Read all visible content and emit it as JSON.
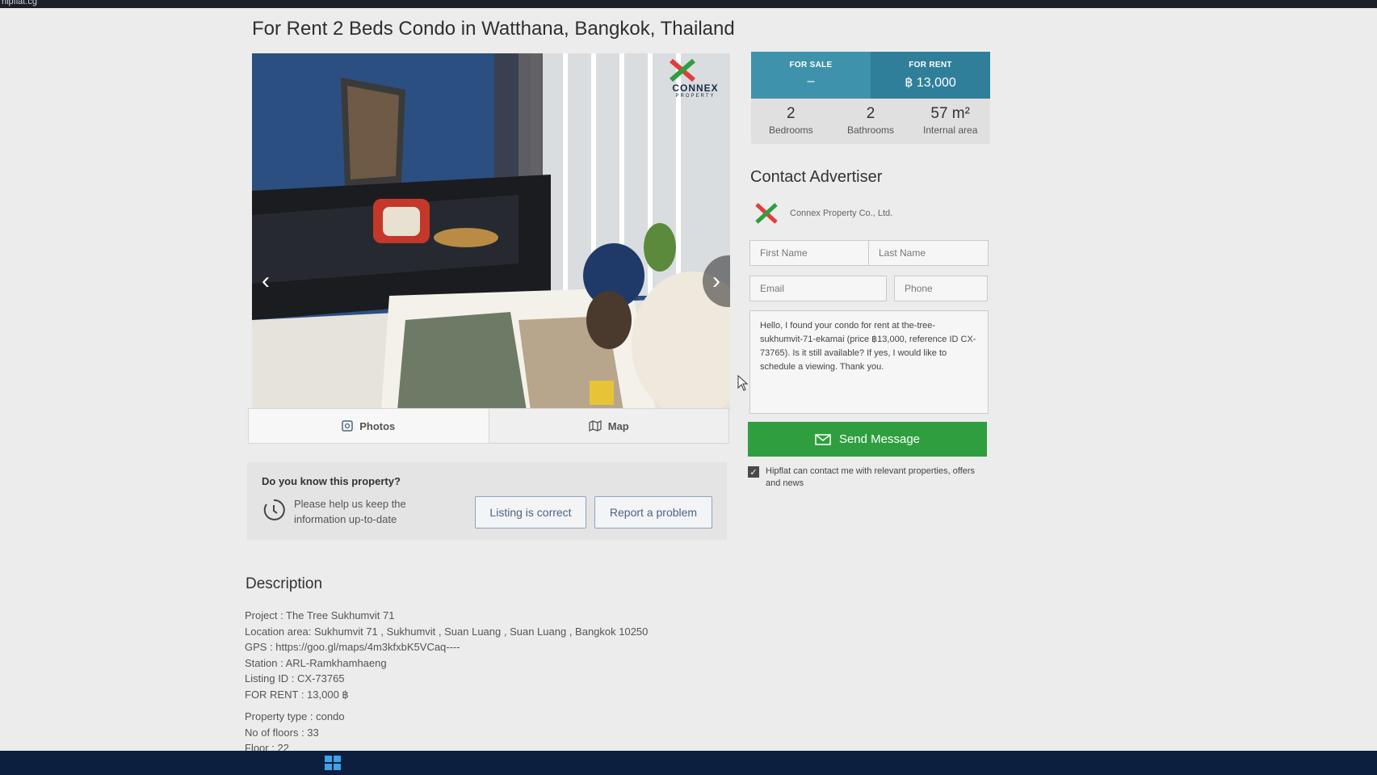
{
  "browser": {
    "url_fragment": "hipflat.cg"
  },
  "page": {
    "title": "For Rent 2 Beds Condo in Watthana, Bangkok, Thailand"
  },
  "gallery": {
    "logo_text": "CONNEX",
    "logo_sub": "PROPERTY",
    "prev_icon": "chevron-left-icon",
    "next_icon": "chevron-right-icon"
  },
  "media_tabs": [
    {
      "label": "Photos",
      "icon": "photo-icon"
    },
    {
      "label": "Map",
      "icon": "map-icon"
    }
  ],
  "know_property": {
    "title": "Do you know this property?",
    "text": "Please help us keep the information up-to-date",
    "correct_label": "Listing is correct",
    "problem_label": "Report a problem"
  },
  "description": {
    "title": "Description",
    "lines": [
      "Project : The Tree Sukhumvit 71",
      "Location area: Sukhumvit 71 , Sukhumvit , Suan Luang , Suan Luang , Bangkok 10250",
      "GPS : https://goo.gl/maps/4m3kfxbK5VCaq----",
      "Station : ARL-Ramkhamhaeng",
      "Listing ID : CX-73765",
      "FOR RENT : 13,000 ฿"
    ],
    "lines2": [
      "Property type : condo",
      "No of floors : 33",
      "Floor : 22"
    ]
  },
  "price": {
    "sale_label": "FOR SALE",
    "sale_value": "–",
    "rent_label": "FOR RENT",
    "rent_value": "฿ 13,000"
  },
  "stats": [
    {
      "value": "2",
      "label": "Bedrooms"
    },
    {
      "value": "2",
      "label": "Bathrooms"
    },
    {
      "value": "57 m²",
      "label": "Internal area"
    }
  ],
  "contact": {
    "title": "Contact Advertiser",
    "advertiser_name": "Connex Property Co., Ltd.",
    "first_name_placeholder": "First Name",
    "last_name_placeholder": "Last Name",
    "email_placeholder": "Email",
    "phone_placeholder": "Phone",
    "message": "Hello, I found your condo for rent at the-tree-sukhumvit-71-ekamai (price ฿13,000, reference ID CX-73765). Is it still available? If yes, I would like to schedule a viewing. Thank you.",
    "send_label": "Send Message",
    "consent_text": "Hipflat can contact me with relevant properties, offers and news",
    "consent_checked": true
  },
  "colors": {
    "price_sale_bg": "#3f92ab",
    "price_rent_bg": "#2f7f9a",
    "send_button": "#2e9e3f",
    "outline_button_text": "#4b6584"
  }
}
